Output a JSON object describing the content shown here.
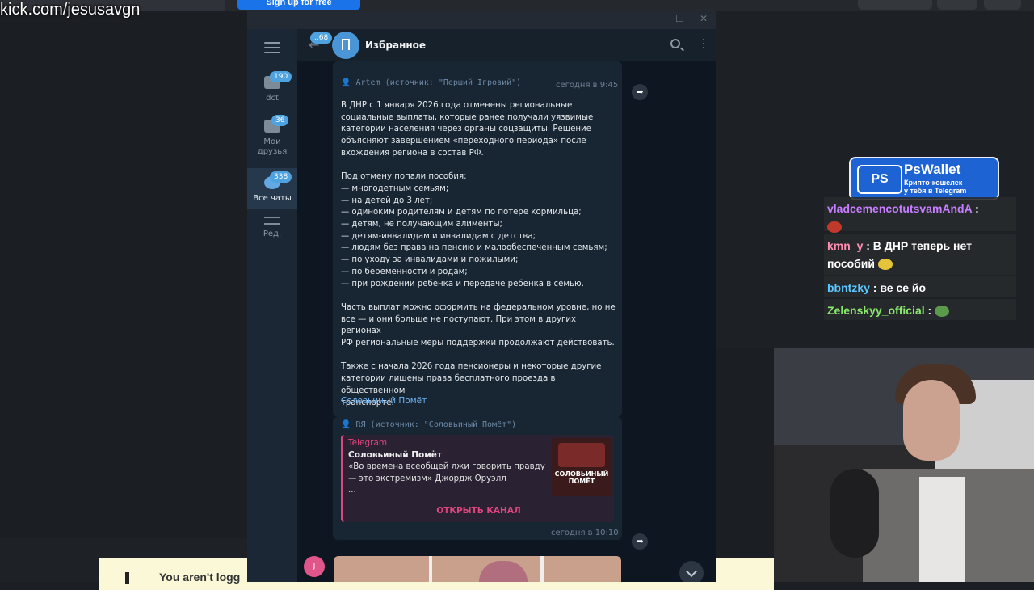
{
  "background": {
    "kick_url": "kick.com/jesusavgn",
    "signup_label": "Sign up for free",
    "notice_text": "You aren't logg"
  },
  "telegram": {
    "window_buttons": [
      "—",
      "☐",
      "✕"
    ],
    "sidebar": {
      "folders": [
        {
          "label": "dct",
          "badge": "190"
        },
        {
          "label": "Мои\nдрузья",
          "badge": "36"
        },
        {
          "label": "Все чаты",
          "badge": "338"
        },
        {
          "label": "Ред.",
          "badge": ""
        }
      ]
    },
    "header": {
      "back_badge": "..68",
      "title": "Избранное"
    },
    "messages": [
      {
        "forward": "Artem (источник: \"Перший Ігровий\")",
        "time": "сегодня в 9:45",
        "text": "В ДНР с 1 января 2026 года отменены региональные\nсоциальные выплаты, которые ранее получали уязвимые\nкатегории населения через органы соцзащиты. Решение\nобъясняют завершением «переходного периода» после\nвхождения региона в состав РФ.\n\nПод отмену попали пособия:\n— многодетным семьям;\n— на детей до 3 лет;\n— одиноким родителям и детям по потере кормильца;\n— детям, не получающим алименты;\n— детям-инвалидам и инвалидам с детства;\n— людям без права на пенсию и малообеспеченным семьям;\n— по уходу за инвалидами и пожилыми;\n— по беременности и родам;\n— при рождении ребенка и передаче ребенка в семью.\n\nЧасть выплат можно оформить на федеральном уровне, но не\nвсе — и они больше не поступают. При этом в других регионах\nРФ региональные меры поддержки продолжают действовать.\n\nТакже с начала 2026 года пенсионеры и некоторые другие\nкатегории лишены права бесплатного проезда в общественном\nтранспорте.",
        "link": "Соловьиный Помёт"
      },
      {
        "forward": "RЯ (источник: \"Соловьиный Помёт\")",
        "time": "сегодня в 10:10",
        "card": {
          "source": "Telegram",
          "title": "Соловьиный Помёт",
          "description": "«Во времена всеобщей лжи говорить правду\n— это экстремизм» Джордж Оруэлл\n...",
          "thumb_text": "СОЛОВЬИНЫЙ\nПОМЁТ",
          "button": "ОТКРЫТЬ КАНАЛ"
        }
      }
    ],
    "avatar_letter": "J"
  },
  "overlay": {
    "wallet": {
      "logo": "PS",
      "name": "PsWallet",
      "subtitle": "Крипто-кошелек\nу тебя в Telegram"
    },
    "chat": [
      {
        "user": "vladcemencotutsvamAndA",
        "message": ":",
        "color": "#c77dff"
      },
      {
        "user": "kmn_y",
        "message": ": В ДНР теперь нет пособий",
        "color": "#ff8fb1"
      },
      {
        "user": "bbntzky",
        "message": ": ве се йо",
        "color": "#5cc8ff"
      },
      {
        "user": "Zelenskyy_official",
        "message": ":",
        "color": "#8bea6b"
      }
    ]
  }
}
